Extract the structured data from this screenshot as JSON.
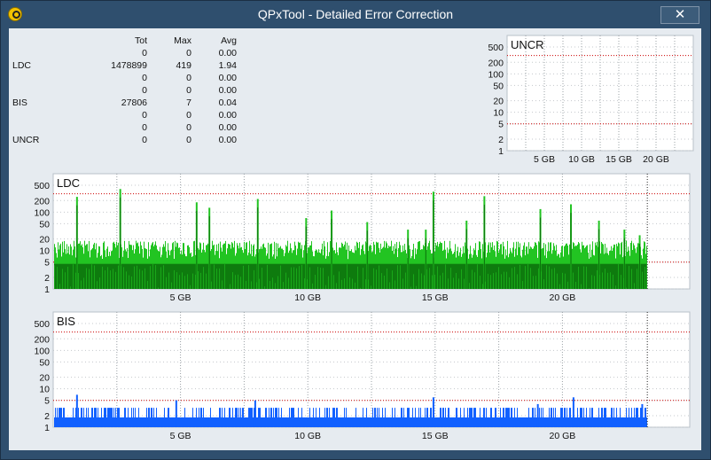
{
  "window": {
    "title": "QPxTool - Detailed Error Correction",
    "close_glyph": "✕"
  },
  "stats": {
    "headers": [
      "",
      "Tot",
      "Max",
      "Avg"
    ],
    "rows": [
      [
        "",
        "0",
        "0",
        "0.00"
      ],
      [
        "LDC",
        "1478899",
        "419",
        "1.94"
      ],
      [
        "",
        "0",
        "0",
        "0.00"
      ],
      [
        "",
        "0",
        "0",
        "0.00"
      ],
      [
        "BIS",
        "27806",
        "7",
        "0.04"
      ],
      [
        "",
        "0",
        "0",
        "0.00"
      ],
      [
        "",
        "0",
        "0",
        "0.00"
      ],
      [
        "UNCR",
        "0",
        "0",
        "0.00"
      ]
    ]
  },
  "colors": {
    "ldc_light": "#22c422",
    "ldc_dark": "#0a6e0a",
    "bis": "#1160ff",
    "threshold": "#cc0000"
  },
  "chart_data": [
    {
      "type": "area",
      "title": "UNCR",
      "yscale": "log",
      "yticks": [
        "500",
        "200",
        "100",
        "50",
        "20",
        "10",
        "5",
        "2",
        "1"
      ],
      "xticks": [
        "5 GB",
        "10 GB",
        "15 GB",
        "20 GB"
      ],
      "xlim": [
        0,
        25
      ],
      "ylim": [
        1,
        1000
      ],
      "thresholds": [
        300,
        5
      ],
      "series": [
        {
          "values": []
        }
      ]
    },
    {
      "type": "area",
      "title": "LDC",
      "yscale": "log",
      "yticks": [
        "500",
        "200",
        "100",
        "50",
        "20",
        "10",
        "5",
        "2",
        "1"
      ],
      "xticks": [
        "5 GB",
        "10 GB",
        "15 GB",
        "20 GB"
      ],
      "xlim": [
        0,
        25
      ],
      "ylim": [
        1,
        1000
      ],
      "thresholds": [
        300,
        5
      ],
      "data_end": 23.3,
      "max": 419,
      "spikes": [
        [
          0.9,
          250
        ],
        [
          2.6,
          400
        ],
        [
          5.6,
          180
        ],
        [
          6.1,
          130
        ],
        [
          8.0,
          220
        ],
        [
          9.9,
          70
        ],
        [
          10.9,
          110
        ],
        [
          12.3,
          55
        ],
        [
          13.9,
          35
        ],
        [
          14.6,
          35
        ],
        [
          14.9,
          340
        ],
        [
          16.2,
          60
        ],
        [
          16.9,
          260
        ],
        [
          19.1,
          120
        ],
        [
          20.3,
          160
        ],
        [
          21.4,
          60
        ],
        [
          22.4,
          35
        ],
        [
          23.0,
          25
        ]
      ]
    },
    {
      "type": "area",
      "title": "BIS",
      "yscale": "log",
      "yticks": [
        "500",
        "200",
        "100",
        "50",
        "20",
        "10",
        "5",
        "2",
        "1"
      ],
      "xticks": [
        "5 GB",
        "10 GB",
        "15 GB",
        "20 GB"
      ],
      "xlim": [
        0,
        25
      ],
      "ylim": [
        1,
        1000
      ],
      "thresholds": [
        300,
        5
      ],
      "data_end": 23.3,
      "max": 7,
      "spikes": [
        [
          0.9,
          7
        ],
        [
          4.8,
          5
        ],
        [
          7.9,
          5
        ],
        [
          14.9,
          6
        ],
        [
          19.0,
          4
        ],
        [
          20.4,
          6
        ],
        [
          23.1,
          4
        ]
      ]
    }
  ]
}
